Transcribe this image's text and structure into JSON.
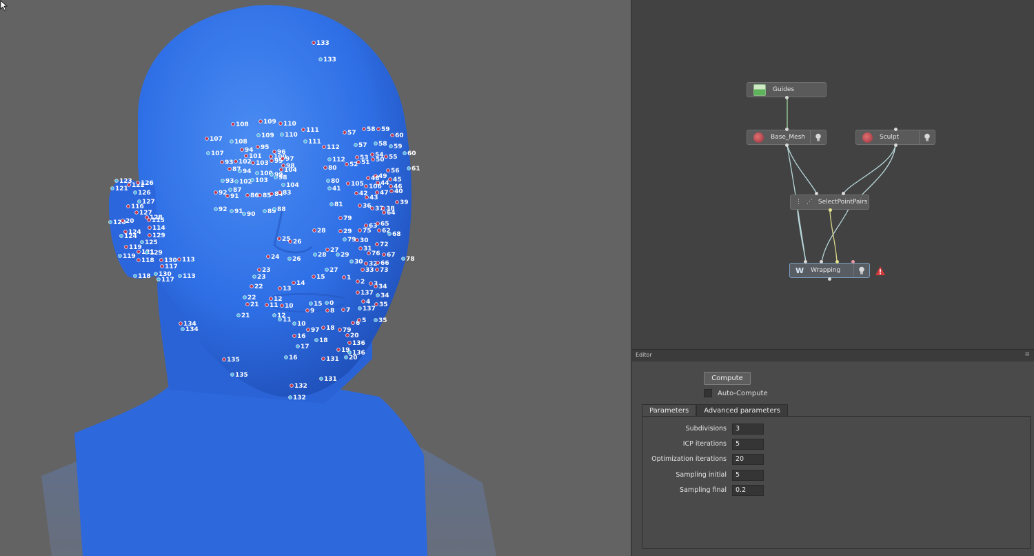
{
  "node_graph": {
    "nodes": [
      {
        "id": "guides",
        "label": "Guides"
      },
      {
        "id": "base_mesh",
        "label": "Base_Mesh"
      },
      {
        "id": "sculpt",
        "label": "Sculpt"
      },
      {
        "id": "select_point_pairs",
        "label": "SelectPointPairs"
      },
      {
        "id": "wrapping",
        "label": "Wrapping",
        "status": "error"
      }
    ],
    "connections": [
      [
        "Guides",
        "Base_Mesh"
      ],
      [
        "Base_Mesh",
        "SelectPointPairs"
      ],
      [
        "Sculpt",
        "SelectPointPairs"
      ],
      [
        "Base_Mesh",
        "Wrapping"
      ],
      [
        "SelectPointPairs",
        "Wrapping"
      ],
      [
        "Sculpt",
        "Wrapping"
      ]
    ]
  },
  "editor": {
    "title": "Editor",
    "menu_icon": "≡",
    "compute_label": "Compute",
    "auto_compute_label": "Auto-Compute",
    "auto_compute_checked": false,
    "tabs": [
      {
        "label": "Parameters",
        "active": true
      },
      {
        "label": "Advanced parameters",
        "active": false
      }
    ],
    "parameters": [
      {
        "label": "Subdivisions",
        "value": "3"
      },
      {
        "label": "ICP iterations",
        "value": "5"
      },
      {
        "label": "Optimization iterations",
        "value": "20"
      },
      {
        "label": "Sampling initial",
        "value": "5"
      },
      {
        "label": "Sampling final",
        "value": "0.2"
      }
    ]
  },
  "viewport": {
    "mesh_color": "#2f6fe6",
    "landmark_colors": {
      "red": "#c0304a",
      "cyan": "#4fb8e8"
    },
    "landmarks": [
      {
        "label": "133",
        "color": "red"
      },
      {
        "label": "133",
        "color": "cyan"
      },
      {
        "label": "108",
        "color": "red"
      },
      {
        "label": "109",
        "color": "red"
      },
      {
        "label": "110",
        "color": "red"
      },
      {
        "label": "111",
        "color": "red"
      },
      {
        "label": "107",
        "color": "red"
      },
      {
        "label": "108",
        "color": "cyan"
      },
      {
        "label": "109",
        "color": "cyan"
      },
      {
        "label": "110",
        "color": "cyan"
      },
      {
        "label": "111",
        "color": "cyan"
      },
      {
        "label": "107",
        "color": "cyan"
      },
      {
        "label": "112",
        "color": "red"
      },
      {
        "label": "57",
        "color": "red"
      },
      {
        "label": "58",
        "color": "red"
      },
      {
        "label": "59",
        "color": "red"
      },
      {
        "label": "60",
        "color": "red"
      },
      {
        "label": "57",
        "color": "cyan"
      },
      {
        "label": "58",
        "color": "cyan"
      },
      {
        "label": "59",
        "color": "cyan"
      },
      {
        "label": "60",
        "color": "cyan"
      },
      {
        "label": "61",
        "color": "cyan"
      },
      {
        "label": "94",
        "color": "red"
      },
      {
        "label": "95",
        "color": "red"
      },
      {
        "label": "96",
        "color": "red"
      },
      {
        "label": "101",
        "color": "red"
      },
      {
        "label": "100",
        "color": "red"
      },
      {
        "label": "99",
        "color": "red"
      },
      {
        "label": "93",
        "color": "red"
      },
      {
        "label": "102",
        "color": "red"
      },
      {
        "label": "103",
        "color": "red"
      },
      {
        "label": "97",
        "color": "red"
      },
      {
        "label": "98",
        "color": "red"
      },
      {
        "label": "87",
        "color": "red"
      },
      {
        "label": "94",
        "color": "cyan"
      },
      {
        "label": "100",
        "color": "cyan"
      },
      {
        "label": "99",
        "color": "cyan"
      },
      {
        "label": "104",
        "color": "red"
      },
      {
        "label": "93",
        "color": "cyan"
      },
      {
        "label": "102",
        "color": "cyan"
      },
      {
        "label": "103",
        "color": "cyan"
      },
      {
        "label": "98",
        "color": "cyan"
      },
      {
        "label": "104",
        "color": "cyan"
      },
      {
        "label": "92",
        "color": "red"
      },
      {
        "label": "87",
        "color": "cyan"
      },
      {
        "label": "91",
        "color": "red"
      },
      {
        "label": "86",
        "color": "red"
      },
      {
        "label": "85",
        "color": "red"
      },
      {
        "label": "84",
        "color": "red"
      },
      {
        "label": "83",
        "color": "red"
      },
      {
        "label": "92",
        "color": "cyan"
      },
      {
        "label": "91",
        "color": "cyan"
      },
      {
        "label": "90",
        "color": "cyan"
      },
      {
        "label": "89",
        "color": "cyan"
      },
      {
        "label": "88",
        "color": "cyan"
      },
      {
        "label": "112",
        "color": "cyan"
      },
      {
        "label": "53",
        "color": "red"
      },
      {
        "label": "54",
        "color": "red"
      },
      {
        "label": "55",
        "color": "red"
      },
      {
        "label": "56",
        "color": "red"
      },
      {
        "label": "80",
        "color": "red"
      },
      {
        "label": "52",
        "color": "red"
      },
      {
        "label": "51",
        "color": "red"
      },
      {
        "label": "50",
        "color": "red"
      },
      {
        "label": "49",
        "color": "red"
      },
      {
        "label": "48",
        "color": "red"
      },
      {
        "label": "80",
        "color": "cyan"
      },
      {
        "label": "105",
        "color": "red"
      },
      {
        "label": "106",
        "color": "red"
      },
      {
        "label": "44",
        "color": "red"
      },
      {
        "label": "45",
        "color": "red"
      },
      {
        "label": "46",
        "color": "red"
      },
      {
        "label": "41",
        "color": "cyan"
      },
      {
        "label": "42",
        "color": "red"
      },
      {
        "label": "43",
        "color": "red"
      },
      {
        "label": "47",
        "color": "red"
      },
      {
        "label": "40",
        "color": "red"
      },
      {
        "label": "39",
        "color": "red"
      },
      {
        "label": "81",
        "color": "cyan"
      },
      {
        "label": "36",
        "color": "red"
      },
      {
        "label": "37",
        "color": "red"
      },
      {
        "label": "38",
        "color": "red"
      },
      {
        "label": "64",
        "color": "red"
      },
      {
        "label": "79",
        "color": "red"
      },
      {
        "label": "63",
        "color": "red"
      },
      {
        "label": "65",
        "color": "red"
      },
      {
        "label": "68",
        "color": "cyan"
      },
      {
        "label": "28",
        "color": "red"
      },
      {
        "label": "29",
        "color": "red"
      },
      {
        "label": "75",
        "color": "red"
      },
      {
        "label": "62",
        "color": "red"
      },
      {
        "label": "79",
        "color": "cyan"
      },
      {
        "label": "25",
        "color": "red"
      },
      {
        "label": "26",
        "color": "red"
      },
      {
        "label": "30",
        "color": "red"
      },
      {
        "label": "31",
        "color": "red"
      },
      {
        "label": "72",
        "color": "red"
      },
      {
        "label": "24",
        "color": "red"
      },
      {
        "label": "27",
        "color": "red"
      },
      {
        "label": "28",
        "color": "cyan"
      },
      {
        "label": "29",
        "color": "cyan"
      },
      {
        "label": "76",
        "color": "red"
      },
      {
        "label": "67",
        "color": "red"
      },
      {
        "label": "78",
        "color": "cyan"
      },
      {
        "label": "23",
        "color": "red"
      },
      {
        "label": "26",
        "color": "cyan"
      },
      {
        "label": "30",
        "color": "cyan"
      },
      {
        "label": "32",
        "color": "red"
      },
      {
        "label": "66",
        "color": "red"
      },
      {
        "label": "23",
        "color": "cyan"
      },
      {
        "label": "27",
        "color": "cyan"
      },
      {
        "label": "33",
        "color": "red"
      },
      {
        "label": "73",
        "color": "red"
      },
      {
        "label": "22",
        "color": "red"
      },
      {
        "label": "14",
        "color": "red"
      },
      {
        "label": "15",
        "color": "red"
      },
      {
        "label": "1",
        "color": "red"
      },
      {
        "label": "2",
        "color": "red"
      },
      {
        "label": "3",
        "color": "red"
      },
      {
        "label": "34",
        "color": "red"
      },
      {
        "label": "13",
        "color": "red"
      },
      {
        "label": "22",
        "color": "cyan"
      },
      {
        "label": "12",
        "color": "red"
      },
      {
        "label": "137",
        "color": "red"
      },
      {
        "label": "34",
        "color": "cyan"
      },
      {
        "label": "21",
        "color": "red"
      },
      {
        "label": "11",
        "color": "red"
      },
      {
        "label": "10",
        "color": "red"
      },
      {
        "label": "15",
        "color": "cyan"
      },
      {
        "label": "0",
        "color": "cyan"
      },
      {
        "label": "4",
        "color": "red"
      },
      {
        "label": "35",
        "color": "red"
      },
      {
        "label": "12",
        "color": "cyan"
      },
      {
        "label": "9",
        "color": "red"
      },
      {
        "label": "8",
        "color": "red"
      },
      {
        "label": "7",
        "color": "red"
      },
      {
        "label": "137",
        "color": "cyan"
      },
      {
        "label": "21",
        "color": "cyan"
      },
      {
        "label": "11",
        "color": "cyan"
      },
      {
        "label": "6",
        "color": "red"
      },
      {
        "label": "5",
        "color": "red"
      },
      {
        "label": "35",
        "color": "cyan"
      },
      {
        "label": "10",
        "color": "cyan"
      },
      {
        "label": "97",
        "color": "red"
      },
      {
        "label": "18",
        "color": "red"
      },
      {
        "label": "79",
        "color": "red"
      },
      {
        "label": "20",
        "color": "red"
      },
      {
        "label": "16",
        "color": "red"
      },
      {
        "label": "18",
        "color": "cyan"
      },
      {
        "label": "136",
        "color": "red"
      },
      {
        "label": "17",
        "color": "cyan"
      },
      {
        "label": "19",
        "color": "red"
      },
      {
        "label": "136",
        "color": "cyan"
      },
      {
        "label": "16",
        "color": "cyan"
      },
      {
        "label": "131",
        "color": "red"
      },
      {
        "label": "20",
        "color": "cyan"
      },
      {
        "label": "134",
        "color": "red"
      },
      {
        "label": "134",
        "color": "cyan"
      },
      {
        "label": "135",
        "color": "red"
      },
      {
        "label": "135",
        "color": "cyan"
      },
      {
        "label": "131",
        "color": "cyan"
      },
      {
        "label": "132",
        "color": "red"
      },
      {
        "label": "132",
        "color": "cyan"
      },
      {
        "label": "123",
        "color": "cyan"
      },
      {
        "label": "122",
        "color": "red"
      },
      {
        "label": "126",
        "color": "red"
      },
      {
        "label": "121",
        "color": "cyan"
      },
      {
        "label": "126",
        "color": "cyan"
      },
      {
        "label": "127",
        "color": "cyan"
      },
      {
        "label": "116",
        "color": "red"
      },
      {
        "label": "127",
        "color": "red"
      },
      {
        "label": "128",
        "color": "red"
      },
      {
        "label": "115",
        "color": "red"
      },
      {
        "label": "120",
        "color": "cyan"
      },
      {
        "label": "20",
        "color": "red"
      },
      {
        "label": "114",
        "color": "red"
      },
      {
        "label": "124",
        "color": "red"
      },
      {
        "label": "129",
        "color": "red"
      },
      {
        "label": "124",
        "color": "cyan"
      },
      {
        "label": "125",
        "color": "cyan"
      },
      {
        "label": "119",
        "color": "red"
      },
      {
        "label": "121",
        "color": "red"
      },
      {
        "label": "129",
        "color": "cyan"
      },
      {
        "label": "119",
        "color": "cyan"
      },
      {
        "label": "118",
        "color": "red"
      },
      {
        "label": "130",
        "color": "red"
      },
      {
        "label": "113",
        "color": "red"
      },
      {
        "label": "117",
        "color": "red"
      },
      {
        "label": "130",
        "color": "cyan"
      },
      {
        "label": "118",
        "color": "cyan"
      },
      {
        "label": "117",
        "color": "cyan"
      },
      {
        "label": "113",
        "color": "cyan"
      }
    ]
  }
}
